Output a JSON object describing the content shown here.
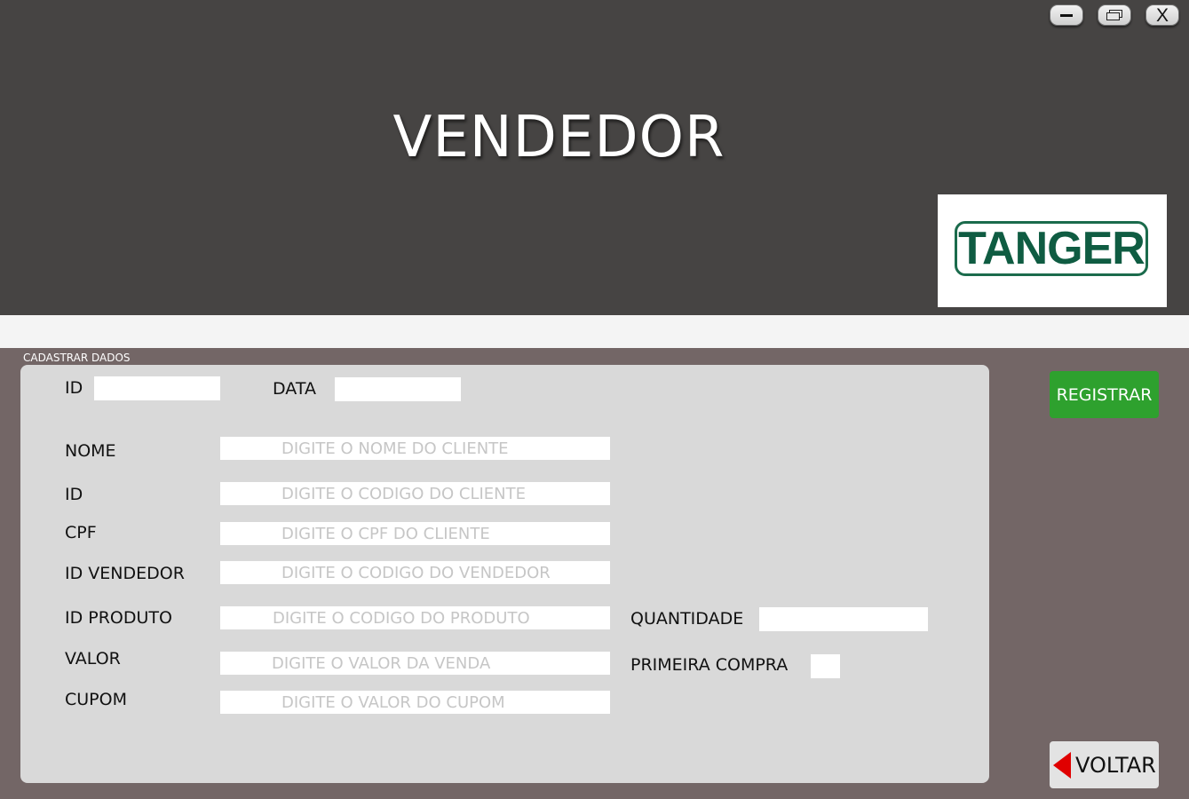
{
  "window": {
    "title": "VENDEDOR",
    "controls": {
      "minimize": "minimize",
      "maximize": "maximize",
      "close_label": "X"
    }
  },
  "logo": {
    "text": "TANGER",
    "color": "#0f5c42"
  },
  "section": {
    "label": "CADASTRAR DADOS"
  },
  "form": {
    "id_label": "ID",
    "id_value": "",
    "data_label": "DATA",
    "data_value": "",
    "nome_label": "NOME",
    "nome_placeholder": "DIGITE O NOME DO CLIENTE",
    "cliente_id_label": "ID",
    "cliente_id_placeholder": "DIGITE O CODIGO DO CLIENTE",
    "cpf_label": "CPF",
    "cpf_placeholder": "DIGITE O CPF DO CLIENTE",
    "vendedor_label": "ID VENDEDOR",
    "vendedor_placeholder": "DIGITE O CODIGO DO VENDEDOR",
    "produto_label": "ID PRODUTO",
    "produto_placeholder": "DIGITE O CODIGO DO PRODUTO",
    "quantidade_label": "QUANTIDADE",
    "quantidade_value": "",
    "valor_label": "VALOR",
    "valor_placeholder": "DIGITE O VALOR DA VENDA",
    "primeira_compra_label": "PRIMEIRA COMPRA",
    "primeira_compra_checked": false,
    "cupom_label": "CUPOM",
    "cupom_placeholder": "DIGITE O VALOR DO CUPOM"
  },
  "buttons": {
    "registrar": "REGISTRAR",
    "voltar": "VOLTAR"
  },
  "colors": {
    "header_bg": "#464443",
    "page_bg": "#736666",
    "panel_bg": "#d9d9d9",
    "registrar_bg": "#2ea12e",
    "voltar_arrow": "#e00000"
  }
}
